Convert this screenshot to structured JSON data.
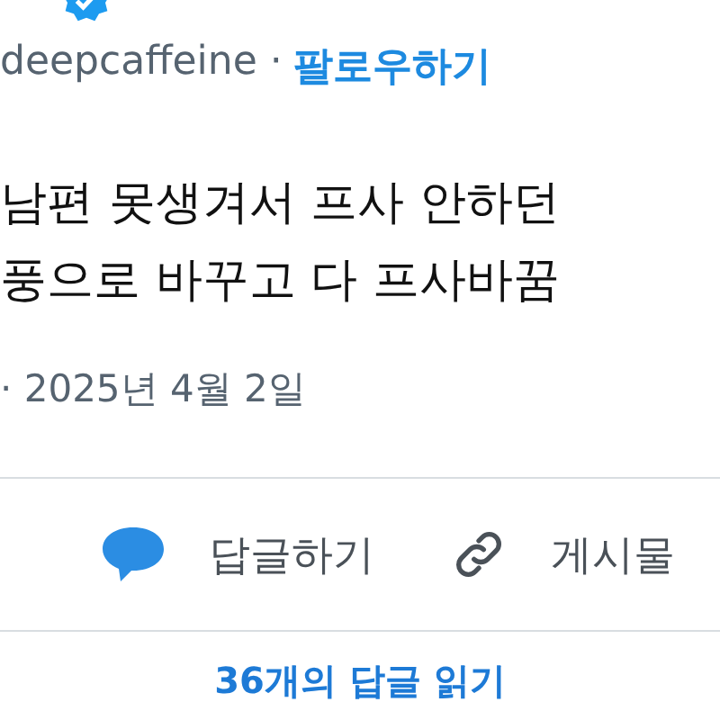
{
  "author": {
    "handle": "deepcaffeine ·",
    "follow": "팔로우하기",
    "verified": true
  },
  "post": {
    "lines": [
      "남편 못생겨서 프사 안하던",
      "풍으로 바꾸고 다 프사바꿈"
    ],
    "date": "· 2025년 4월 2일"
  },
  "actions": [
    {
      "kind": "reply",
      "label": "답글하기"
    },
    {
      "kind": "link",
      "label": "게시물"
    }
  ],
  "replies_button": "36개의 답글 읽기"
}
